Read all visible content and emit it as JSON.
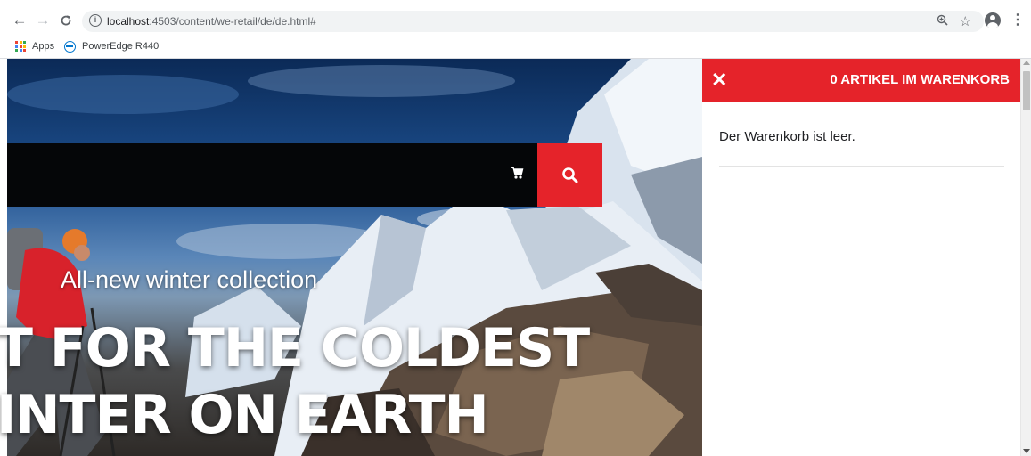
{
  "browser": {
    "url_host": "localhost",
    "url_path": ":4503/content/we-retail/de/de.html#",
    "back_icon": "arrow-left-icon",
    "forward_icon": "arrow-right-icon",
    "reload_icon": "reload-icon",
    "info_icon_glyph": "i",
    "zoom_icon": "zoom-icon",
    "star_icon": "star-icon",
    "profile_icon": "account-icon",
    "menu_icon": "kebab-menu-icon"
  },
  "bookmarks": [
    {
      "label": "Apps",
      "icon": "apps-grid-icon"
    },
    {
      "label": "PowerEdge R440",
      "icon": "dell-logo-icon"
    }
  ],
  "header": {
    "cart_icon": "cart-icon",
    "search_icon": "search-icon"
  },
  "hero": {
    "subtitle": "All-new winter collection",
    "headline_line1": "T FOR THE COLDEST",
    "headline_line2": "INTER ON EARTH"
  },
  "cart": {
    "close_icon": "close-icon",
    "close_glyph": "✕",
    "title": "0 ARTIKEL IM WARENKORB",
    "empty_message": "Der Warenkorb ist leer."
  },
  "colors": {
    "brand_red": "#e5232a",
    "search_bar": "#050608"
  }
}
